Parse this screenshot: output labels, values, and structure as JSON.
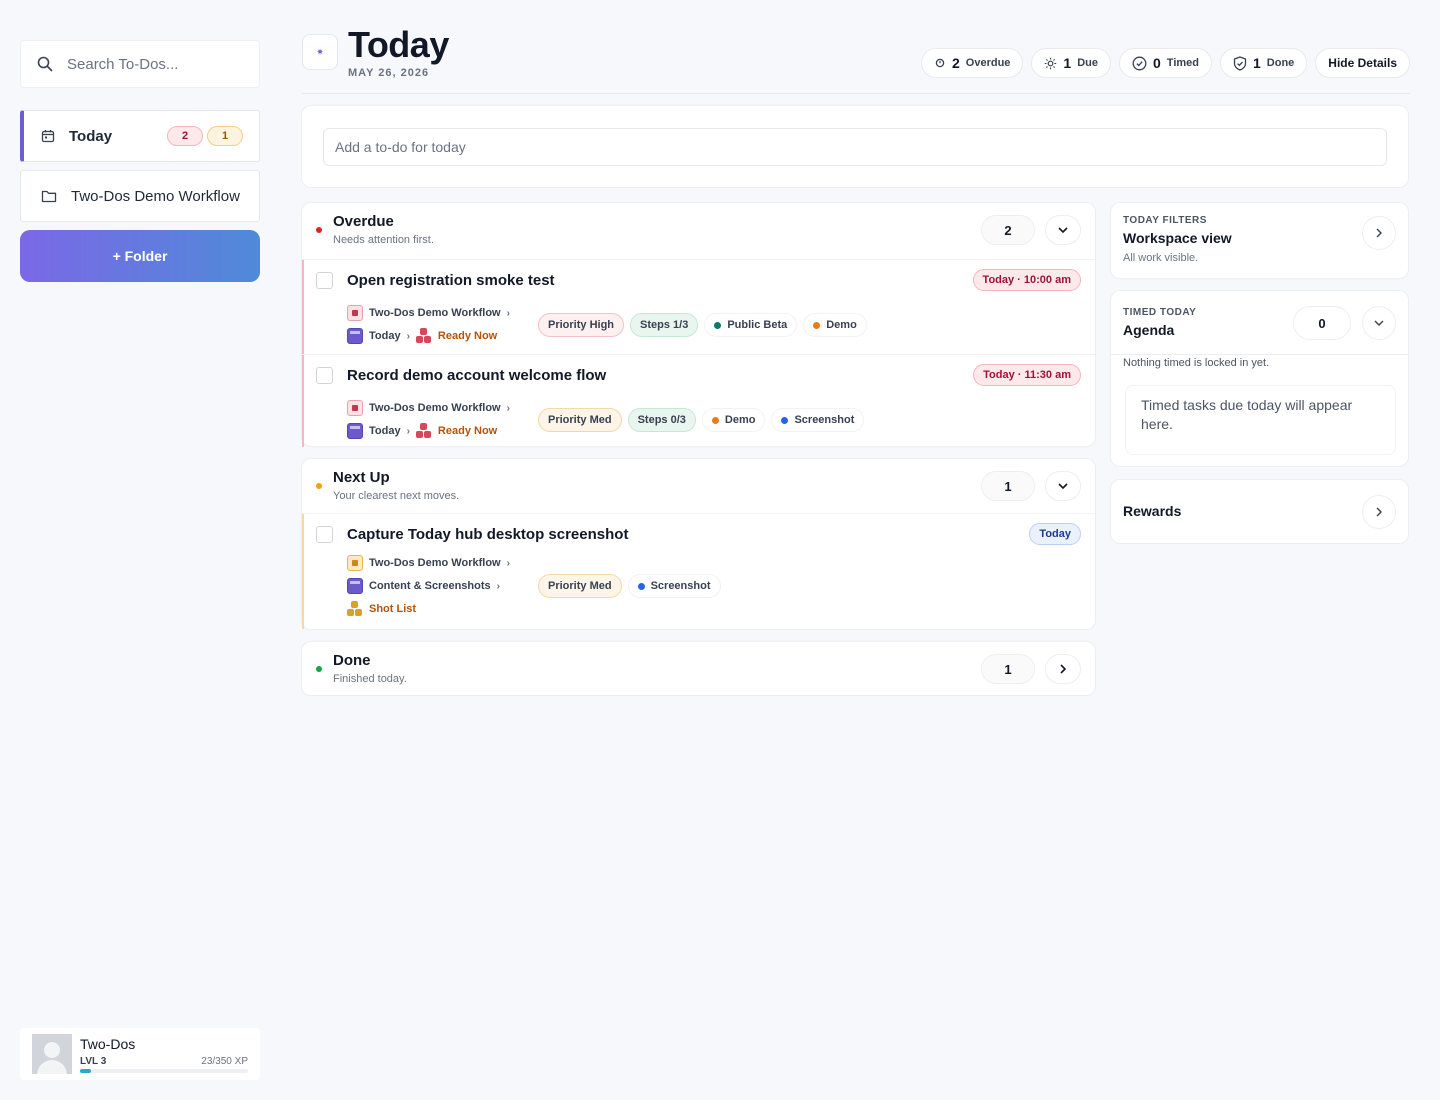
{
  "sidebar": {
    "search_placeholder": "Search To-Dos...",
    "nav": [
      {
        "label": "Today",
        "badges": [
          "2",
          "1"
        ]
      },
      {
        "label": "Two-Dos Demo Workflow"
      }
    ],
    "folder_button": "+ Folder",
    "profile": {
      "name": "Two-Dos",
      "level": "LVL 3",
      "xp": "23/350 XP",
      "xp_progress": 0.066
    }
  },
  "header": {
    "title": "Today",
    "date": "MAY 26, 2026",
    "stats": [
      {
        "icon": "clock-alert-icon",
        "count": "2",
        "label": "Overdue"
      },
      {
        "icon": "sun-icon",
        "count": "1",
        "label": "Due"
      },
      {
        "icon": "clock-icon",
        "count": "0",
        "label": "Timed"
      },
      {
        "icon": "shield-check-icon",
        "count": "1",
        "label": "Done"
      }
    ],
    "hide_details": "Hide Details"
  },
  "add_todo": {
    "placeholder": "Add a to-do for today"
  },
  "sections": {
    "overdue": {
      "title": "Overdue",
      "subtitle": "Needs attention first.",
      "count": "2",
      "color": "#dc2626",
      "tasks": [
        {
          "title": "Open registration smoke test",
          "due": "Today · 10:00 am",
          "project": "Two-Dos Demo Workflow",
          "list": "Today",
          "status": "Ready Now",
          "priority": "Priority High",
          "steps": "Steps 1/3",
          "tags": [
            {
              "name": "Public Beta",
              "color": "#0f766e"
            },
            {
              "name": "Demo",
              "color": "#ea7a1a"
            }
          ]
        },
        {
          "title": "Record demo account welcome flow",
          "due": "Today · 11:30 am",
          "project": "Two-Dos Demo Workflow",
          "list": "Today",
          "status": "Ready Now",
          "priority": "Priority Med",
          "steps": "Steps 0/3",
          "tags": [
            {
              "name": "Demo",
              "color": "#ea7a1a"
            },
            {
              "name": "Screenshot",
              "color": "#2563eb"
            }
          ]
        }
      ]
    },
    "nextup": {
      "title": "Next Up",
      "subtitle": "Your clearest next moves.",
      "count": "1",
      "color": "#f59e0b",
      "tasks": [
        {
          "title": "Capture Today hub desktop screenshot",
          "due": "Today",
          "project": "Two-Dos Demo Workflow",
          "list": "Content & Screenshots",
          "status": "Shot List",
          "priority": "Priority Med",
          "tags": [
            {
              "name": "Screenshot",
              "color": "#2563eb"
            }
          ]
        }
      ]
    },
    "done": {
      "title": "Done",
      "subtitle": "Finished today.",
      "count": "1",
      "color": "#16a34a"
    }
  },
  "right": {
    "filters": {
      "kicker": "TODAY FILTERS",
      "title": "Workspace view",
      "subtitle": "All work visible."
    },
    "agenda": {
      "kicker": "TIMED TODAY",
      "title": "Agenda",
      "count": "0",
      "note": "Nothing timed is locked in yet.",
      "empty": "Timed tasks due today will appear here."
    },
    "rewards": {
      "title": "Rewards"
    }
  },
  "colors": {
    "accent": "#6d5bd8",
    "overdue": "#dc2626",
    "nextup": "#f59e0b",
    "done": "#16a34a"
  }
}
